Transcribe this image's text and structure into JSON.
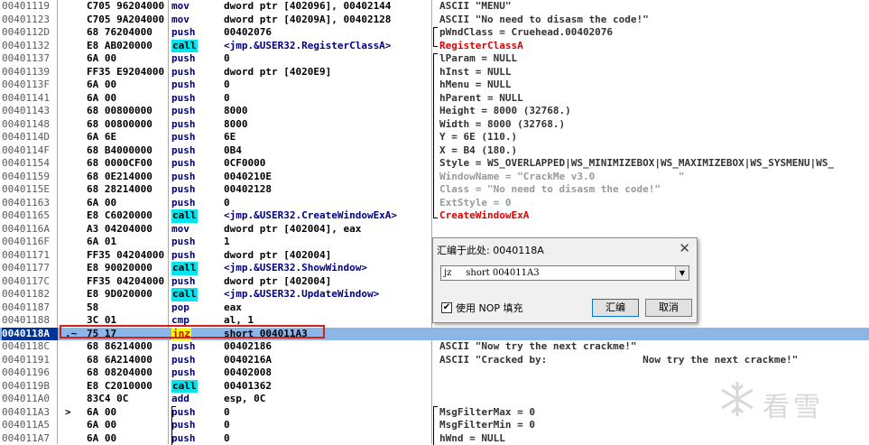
{
  "rows": [
    {
      "addr": "00401119",
      "mark": "",
      "hex": "C705 96204000",
      "mn": "mov",
      "op": "dword ptr [402096], 00402144",
      "cm": "ASCII \"MENU\""
    },
    {
      "addr": "00401123",
      "mark": "",
      "hex": "C705 9A204000",
      "mn": "mov",
      "op": "dword ptr [40209A], 00402128",
      "cm": "ASCII \"No need to disasm the code!\""
    },
    {
      "addr": "0040112D",
      "mark": "",
      "hex": "68 76204000",
      "mn": "push",
      "op": "00402076",
      "cm": "pWndClass = Cruehead.00402076"
    },
    {
      "addr": "00401132",
      "mark": "",
      "hex": "E8 AB020000",
      "mn": "call",
      "op": "<jmp.&USER32.RegisterClassA>",
      "cm": "RegisterClassA"
    },
    {
      "addr": "00401137",
      "mark": "",
      "hex": "6A 00",
      "mn": "push",
      "op": "0",
      "cm": "lParam = NULL"
    },
    {
      "addr": "00401139",
      "mark": "",
      "hex": "FF35 E9204000",
      "mn": "push",
      "op": "dword ptr [4020E9]",
      "cm": "hInst = NULL"
    },
    {
      "addr": "0040113F",
      "mark": "",
      "hex": "6A 00",
      "mn": "push",
      "op": "0",
      "cm": "hMenu = NULL"
    },
    {
      "addr": "00401141",
      "mark": "",
      "hex": "6A 00",
      "mn": "push",
      "op": "0",
      "cm": "hParent = NULL"
    },
    {
      "addr": "00401143",
      "mark": "",
      "hex": "68 00800000",
      "mn": "push",
      "op": "8000",
      "cm": "Height = 8000 (32768.)"
    },
    {
      "addr": "00401148",
      "mark": "",
      "hex": "68 00800000",
      "mn": "push",
      "op": "8000",
      "cm": "Width = 8000 (32768.)"
    },
    {
      "addr": "0040114D",
      "mark": "",
      "hex": "6A 6E",
      "mn": "push",
      "op": "6E",
      "cm": "Y = 6E (110.)"
    },
    {
      "addr": "0040114F",
      "mark": "",
      "hex": "68 B4000000",
      "mn": "push",
      "op": "0B4",
      "cm": "X = B4 (180.)"
    },
    {
      "addr": "00401154",
      "mark": "",
      "hex": "68 0000CF00",
      "mn": "push",
      "op": "0CF0000",
      "cm": "Style = WS_OVERLAPPED|WS_MINIMIZEBOX|WS_MAXIMIZEBOX|WS_SYSMENU|WS_"
    },
    {
      "addr": "00401159",
      "mark": "",
      "hex": "68 0E214000",
      "mn": "push",
      "op": "0040210E",
      "cm": "WindowName = \"CrackMe v3.0              \""
    },
    {
      "addr": "0040115E",
      "mark": "",
      "hex": "68 28214000",
      "mn": "push",
      "op": "00402128",
      "cm": "Class = \"No need to disasm the code!\""
    },
    {
      "addr": "00401163",
      "mark": "",
      "hex": "6A 00",
      "mn": "push",
      "op": "0",
      "cm": "ExtStyle = 0"
    },
    {
      "addr": "00401165",
      "mark": "",
      "hex": "E8 C6020000",
      "mn": "call",
      "op": "<jmp.&USER32.CreateWindowExA>",
      "cm": "CreateWindowExA"
    },
    {
      "addr": "0040116A",
      "mark": "",
      "hex": "A3 04204000",
      "mn": "mov",
      "op": "dword ptr [402004], eax",
      "cm": ""
    },
    {
      "addr": "0040116F",
      "mark": "",
      "hex": "6A 01",
      "mn": "push",
      "op": "1",
      "cm": ""
    },
    {
      "addr": "00401171",
      "mark": "",
      "hex": "FF35 04204000",
      "mn": "push",
      "op": "dword ptr [402004]",
      "cm": ""
    },
    {
      "addr": "00401177",
      "mark": "",
      "hex": "E8 90020000",
      "mn": "call",
      "op": "<jmp.&USER32.ShowWindow>",
      "cm": ""
    },
    {
      "addr": "0040117C",
      "mark": "",
      "hex": "FF35 04204000",
      "mn": "push",
      "op": "dword ptr [402004]",
      "cm": ""
    },
    {
      "addr": "00401182",
      "mark": "",
      "hex": "E8 9D020000",
      "mn": "call",
      "op": "<jmp.&USER32.UpdateWindow>",
      "cm": ""
    },
    {
      "addr": "00401187",
      "mark": "",
      "hex": "58",
      "mn": "pop",
      "op": "eax",
      "cm": ""
    },
    {
      "addr": "00401188",
      "mark": "",
      "hex": "3C 01",
      "mn": "cmp",
      "op": "al, 1",
      "cm": ""
    },
    {
      "addr": "0040118A",
      "mark": ".~",
      "hex": "75 17",
      "mn": "jnz",
      "op": "short 004011A3",
      "cm": ""
    },
    {
      "addr": "0040118C",
      "mark": "",
      "hex": "68 86214000",
      "mn": "push",
      "op": "00402186",
      "cm": "ASCII \"Now try the next crackme!\""
    },
    {
      "addr": "00401191",
      "mark": "",
      "hex": "68 6A214000",
      "mn": "push",
      "op": "0040216A",
      "cm": "ASCII \"Cracked by:                Now try the next crackme!\""
    },
    {
      "addr": "00401196",
      "mark": "",
      "hex": "68 08204000",
      "mn": "push",
      "op": "00402008",
      "cm": ""
    },
    {
      "addr": "0040119B",
      "mark": "",
      "hex": "E8 C2010000",
      "mn": "call",
      "op": "00401362",
      "cm": ""
    },
    {
      "addr": "004011A0",
      "mark": "",
      "hex": "83C4 0C",
      "mn": "add",
      "op": "esp, 0C",
      "cm": ""
    },
    {
      "addr": "004011A3",
      "mark": ">",
      "hex": "6A 00",
      "mn": "push",
      "op": "0",
      "cm": "MsgFilterMax = 0"
    },
    {
      "addr": "004011A5",
      "mark": "",
      "hex": "6A 00",
      "mn": "push",
      "op": "0",
      "cm": "MsgFilterMin = 0"
    },
    {
      "addr": "004011A7",
      "mark": "",
      "hex": "6A 00",
      "mn": "push",
      "op": "0",
      "cm": "hWnd = NULL"
    }
  ],
  "dialog": {
    "title": "汇编于此处: 0040118A",
    "close": "✕",
    "combo_value": "jz     short 004011A3",
    "checkbox_label": "使用 NOP 填充",
    "checkbox_checked": "✔",
    "assemble_label": "汇编",
    "cancel_label": "取消"
  },
  "watermark": {
    "text": "看雪"
  },
  "colors": {
    "call_bg": "#00e5ee",
    "jmp_bg": "#ffff00",
    "selection": "#8db6e8",
    "red_box": "#d02020"
  }
}
